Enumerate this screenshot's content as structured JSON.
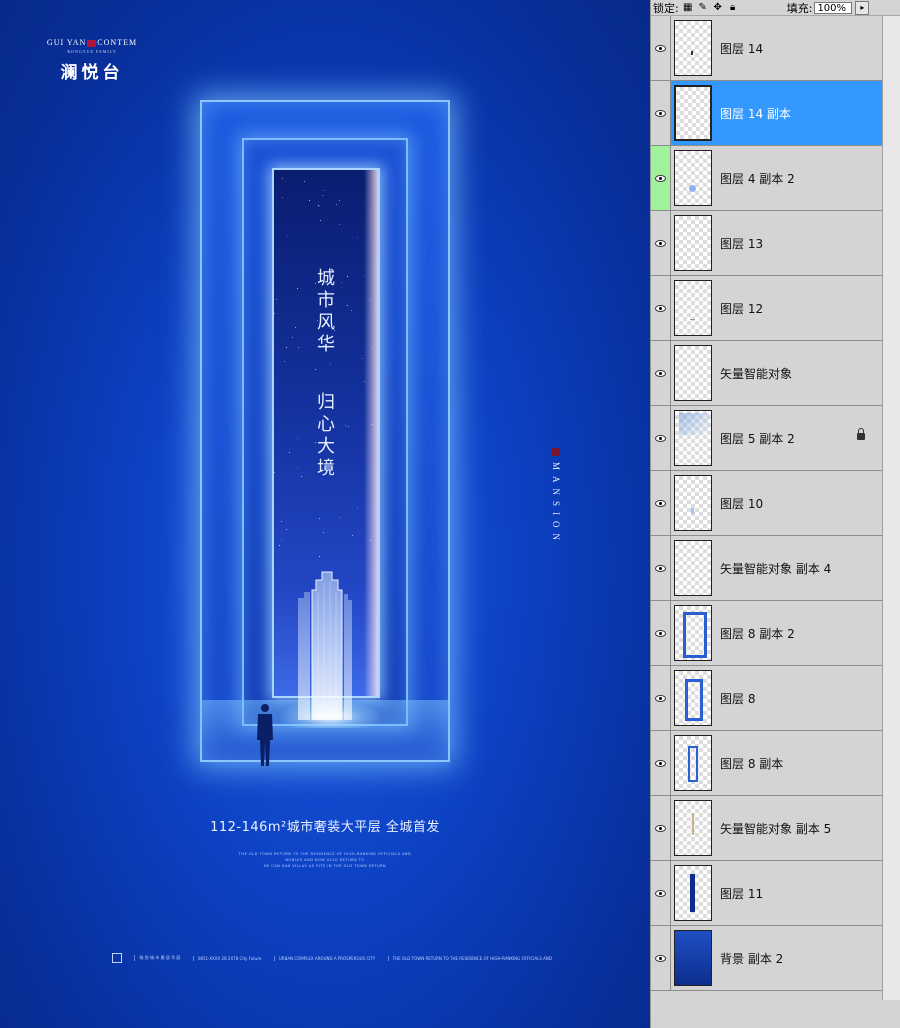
{
  "poster": {
    "brand_en_left": "GUI YAN",
    "brand_en_right": "CONTEM",
    "brand_sub": "RONGYUE FAMILY",
    "brand_cn": "澜悦台",
    "slogan_1": "城市风华",
    "slogan_2": "归心大境",
    "side_label": "MANSION",
    "headline": "112-146m²城市奢装大平层 全城首发",
    "fine_1": "THE OLD TOWN RETURN TO THE RESIDENCE OF HIGH-RANKING OFFICIALS AND",
    "fine_2": "NOBLES AND NOW ALSO RETURN TO",
    "fine_3": "HE CAN SAN VILLAS AS SITE IN THE OLD TOWN RETURN",
    "footer_1": "暗 悦 城 市    雅 居 华 庭",
    "footer_2": "0851-XXXX 28 2X78 City Future",
    "footer_3": "URBAN COMPLEX AROUND A PROSPEROUS CITY",
    "footer_4": "THE OLD TOWN RETURN TO THE RESIDENCE OF HIGH-RANKING OFFICIALS AND"
  },
  "panel": {
    "lock_label": "锁定:",
    "fill_label": "填充:",
    "fill_value": "100%",
    "layers": [
      {
        "name": "图层 14",
        "visible": true,
        "selected": false
      },
      {
        "name": "图层 14 副本",
        "visible": true,
        "selected": true
      },
      {
        "name": "图层 4 副本 2",
        "visible": true,
        "selected": false,
        "highlight": "#9ff29a"
      },
      {
        "name": "图层 13",
        "visible": true,
        "selected": false
      },
      {
        "name": "图层 12",
        "visible": true,
        "selected": false
      },
      {
        "name": "矢量智能对象",
        "visible": true,
        "selected": false
      },
      {
        "name": "图层 5 副本 2",
        "visible": true,
        "selected": false,
        "locked": true
      },
      {
        "name": "图层 10",
        "visible": true,
        "selected": false
      },
      {
        "name": "矢量智能对象 副本 4",
        "visible": true,
        "selected": false
      },
      {
        "name": "图层 8 副本 2",
        "visible": true,
        "selected": false
      },
      {
        "name": "图层 8",
        "visible": true,
        "selected": false
      },
      {
        "name": "图层 8 副本",
        "visible": true,
        "selected": false
      },
      {
        "name": "矢量智能对象 副本 5",
        "visible": true,
        "selected": false
      },
      {
        "name": "图层 11",
        "visible": true,
        "selected": false
      },
      {
        "name": "背景 副本 2",
        "visible": true,
        "selected": false
      }
    ]
  }
}
